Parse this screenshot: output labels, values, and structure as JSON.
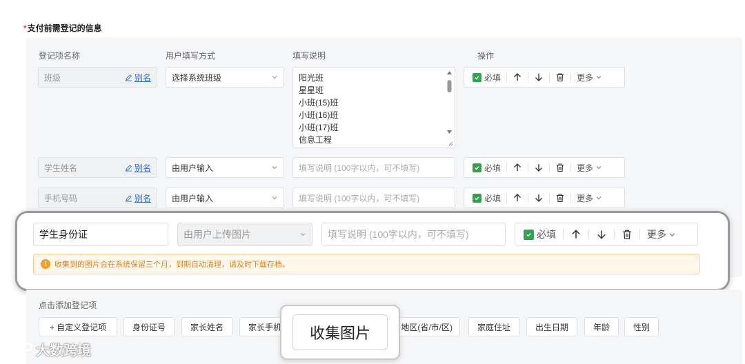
{
  "section": {
    "required_mark": "*",
    "title": "支付前需登记的信息"
  },
  "headers": {
    "name": "登记项名称",
    "method": "用户填写方式",
    "desc": "填写说明",
    "ops": "操作"
  },
  "common": {
    "alias": "别名",
    "required": "必填",
    "more": "更多",
    "desc_placeholder": "填写说明 (100字以内，可不填写)"
  },
  "rows": [
    {
      "name": "班级",
      "method": "选择系统班级",
      "options": [
        "阳光班",
        "星星班",
        "小班(15)班",
        "小班(16)班",
        "小班(17)班",
        "信息工程"
      ]
    },
    {
      "name": "学生姓名",
      "method": "由用户输入"
    },
    {
      "name": "手机号码",
      "method": "由用户输入"
    }
  ],
  "focused": {
    "name": "学生身份证",
    "method": "由用户上传图片",
    "warning": "收集到的图片会在系统保留三个月，到期自动清理，请及时下载存档。"
  },
  "add": {
    "label": "点击添加登记项",
    "chips": [
      "+ 自定义登记项",
      "身份证号",
      "家长姓名",
      "家长手机",
      "地区(省/市/区)",
      "家庭住址",
      "出生日期",
      "年龄",
      "性别"
    ]
  },
  "tooltip": "收集图片",
  "watermark": "大数跨境",
  "colors": {
    "accent": "#2f6fd6",
    "check": "#2ea44f",
    "warning": "#f0a030",
    "required": "#e5484d"
  }
}
